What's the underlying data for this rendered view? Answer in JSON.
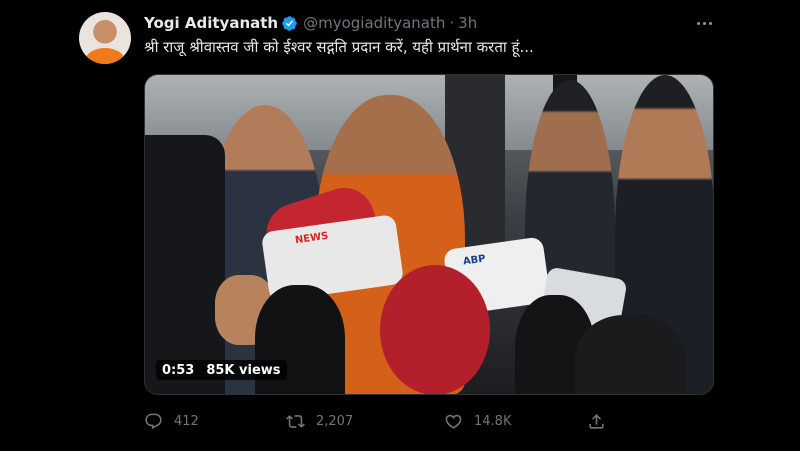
{
  "tweet": {
    "author_name": "Yogi Adityanath",
    "author_handle": "@myogiadityanath",
    "separator": "·",
    "time_ago": "3h",
    "text": "श्री राजू श्रीवास्तव जी को ईश्वर सद्गति प्रदान करें, यही प्रार्थना करता हूं...",
    "verified": true
  },
  "media": {
    "duration": "0:53",
    "views": "85K views",
    "mic_logo_1": "NEWS",
    "mic_logo_2": "ABP"
  },
  "actions": {
    "reply_count": "412",
    "retweet_count": "2,207",
    "like_count": "14.8K"
  },
  "colors": {
    "background": "#000000",
    "text_primary": "#e7e9ea",
    "text_secondary": "#71767b",
    "verified_badge": "#1d9bf0"
  },
  "icons": {
    "verified": "verified-badge-icon",
    "more": "more-options-icon",
    "reply": "reply-icon",
    "retweet": "retweet-icon",
    "like": "heart-icon",
    "share": "share-icon"
  }
}
